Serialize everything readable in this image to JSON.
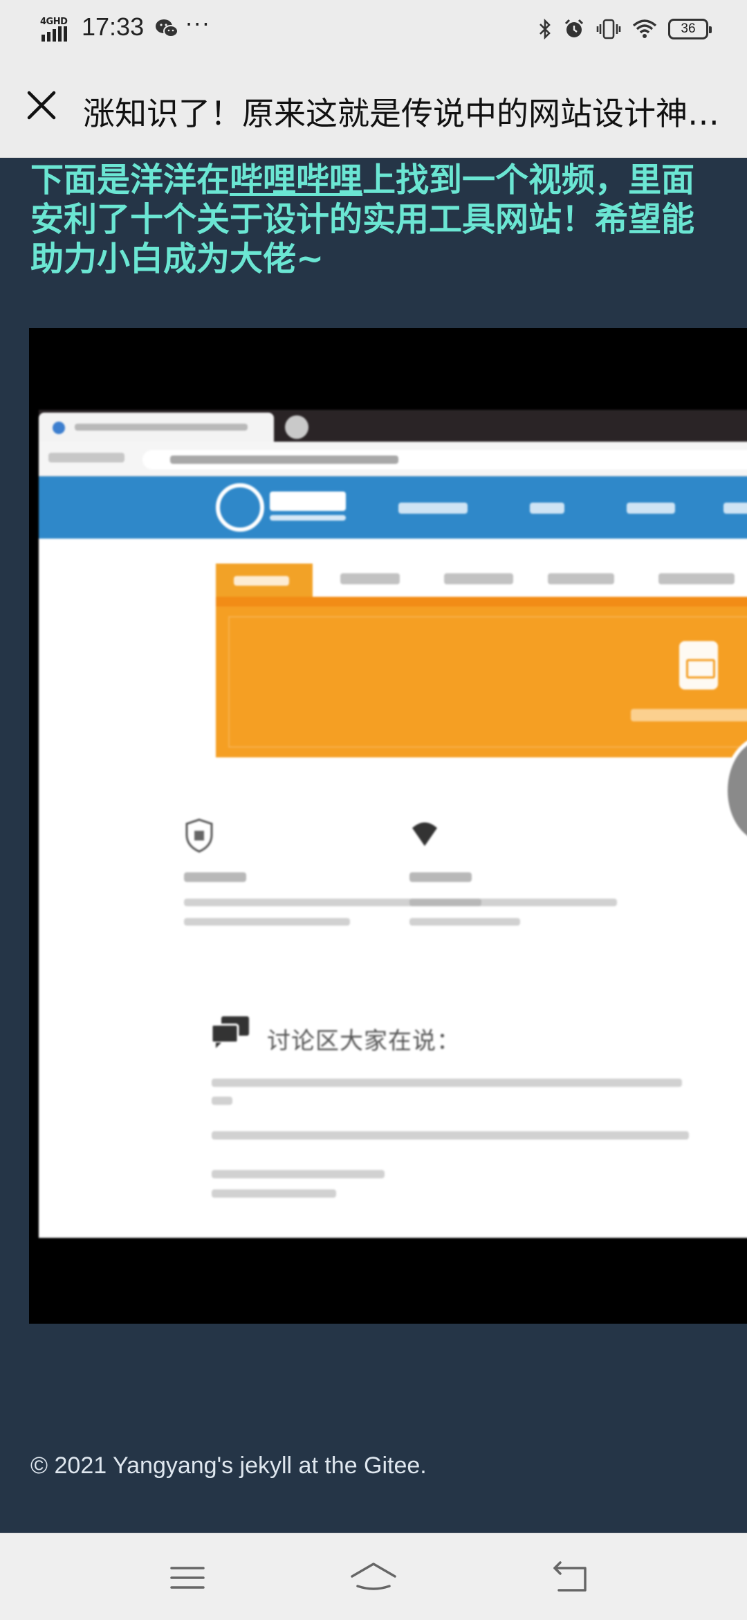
{
  "status_bar": {
    "network": "4GHD",
    "time": "17:33",
    "more": "···",
    "battery": "36"
  },
  "title_bar": {
    "title": "涨知识了！原来这就是传说中的网站设计神器！"
  },
  "article": {
    "before_link": "下面是洋洋在",
    "link_text": "哔哩哔哩",
    "after_link": "上找到一个视频，里面安利了十个关于设计的实用工具网站！希望能助力小白成为大佬~"
  },
  "video": {
    "forum_heading": "讨论区大家在说："
  },
  "footer": {
    "copyright": "© 2021 Yangyang's jekyll at the Gitee."
  }
}
